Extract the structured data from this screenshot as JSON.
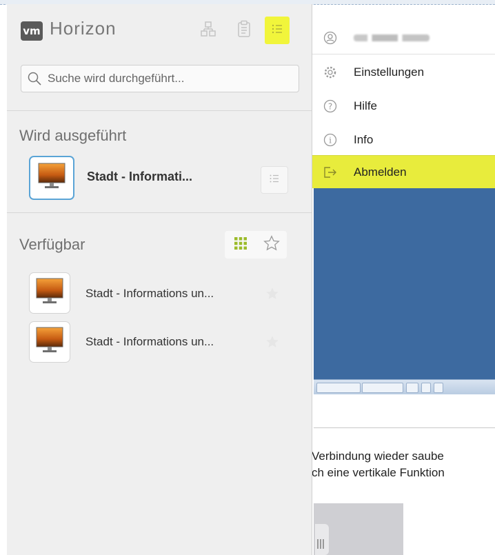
{
  "app": {
    "logo_text": "vm",
    "title": "Horizon"
  },
  "header_buttons": [
    {
      "icon": "network-icon",
      "active": false
    },
    {
      "icon": "clipboard-icon",
      "active": false
    },
    {
      "icon": "menu-list-icon",
      "active": true
    }
  ],
  "search": {
    "placeholder": "Suche wird durchgeführt..."
  },
  "running": {
    "title": "Wird ausgeführt",
    "items": [
      {
        "name": "Stadt - Informati...",
        "icon": "desktop-icon"
      }
    ]
  },
  "available": {
    "title": "Verfügbar",
    "view_modes": [
      "grid-icon",
      "star-outline-icon"
    ],
    "items": [
      {
        "name": "Stadt - Informations un...",
        "favorite": false
      },
      {
        "name": "Stadt - Informations un...",
        "favorite": false
      }
    ]
  },
  "menu": {
    "items": [
      {
        "label": "Einstellungen",
        "icon": "gear-icon"
      },
      {
        "label": "Hilfe",
        "icon": "help-icon"
      },
      {
        "label": "Info",
        "icon": "info-icon"
      },
      {
        "label": "Abmelden",
        "icon": "logout-icon",
        "highlighted": true
      }
    ]
  },
  "background_text": {
    "line1": "Verbindung wieder saube",
    "line2": "ch eine vertikale Funktion"
  },
  "colors": {
    "highlight_yellow": "#e8ec3c",
    "remote_desktop_blue": "#3d6aa0",
    "running_thumb_border": "#5aa4d6",
    "grid_icon_green": "#9bbb2a"
  }
}
